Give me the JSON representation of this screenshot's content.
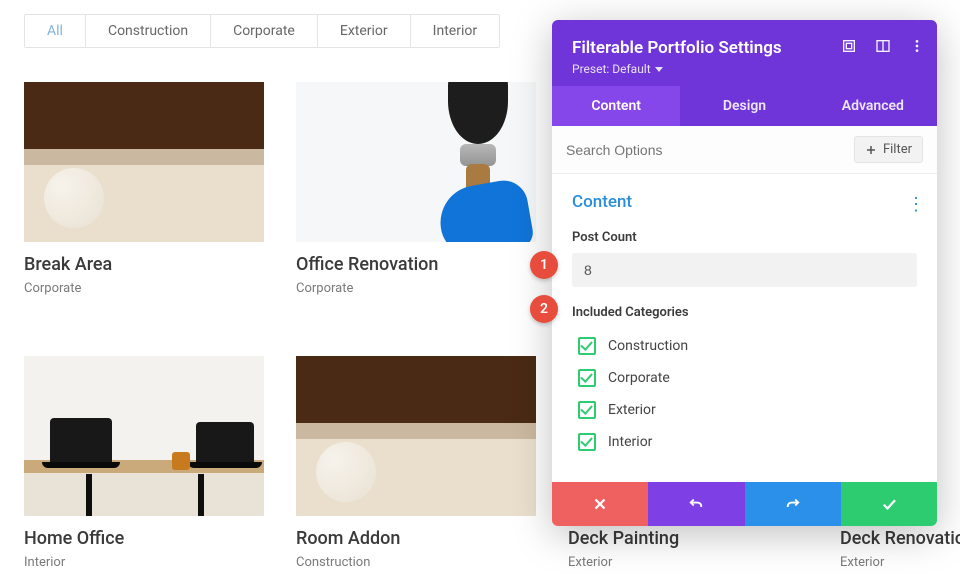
{
  "filters": {
    "items": [
      {
        "label": "All",
        "active": true
      },
      {
        "label": "Construction",
        "active": false
      },
      {
        "label": "Corporate",
        "active": false
      },
      {
        "label": "Exterior",
        "active": false
      },
      {
        "label": "Interior",
        "active": false
      }
    ]
  },
  "portfolio": [
    {
      "title": "Break Area",
      "category": "Corporate",
      "thumb": "wood"
    },
    {
      "title": "Office Renovation",
      "category": "Corporate",
      "thumb": "brush"
    },
    {
      "title": "",
      "category": "",
      "thumb": "hidden"
    },
    {
      "title": "",
      "category": "",
      "thumb": "hidden"
    },
    {
      "title": "Home Office",
      "category": "Interior",
      "thumb": "office"
    },
    {
      "title": "Room Addon",
      "category": "Construction",
      "thumb": "wood"
    },
    {
      "title": "Deck Painting",
      "category": "Exterior",
      "thumb": "hidden"
    },
    {
      "title": "Deck Renovation",
      "category": "Exterior",
      "thumb": "hidden"
    }
  ],
  "panel": {
    "title": "Filterable Portfolio Settings",
    "preset": "Preset: Default",
    "tabs": {
      "content": "Content",
      "design": "Design",
      "advanced": "Advanced"
    },
    "search_placeholder": "Search Options",
    "filter_button": "Filter",
    "section_title": "Content",
    "post_count_label": "Post Count",
    "post_count_value": "8",
    "categories_label": "Included Categories",
    "categories": [
      "Construction",
      "Corporate",
      "Exterior",
      "Interior"
    ]
  },
  "callouts": {
    "one": "1",
    "two": "2"
  }
}
